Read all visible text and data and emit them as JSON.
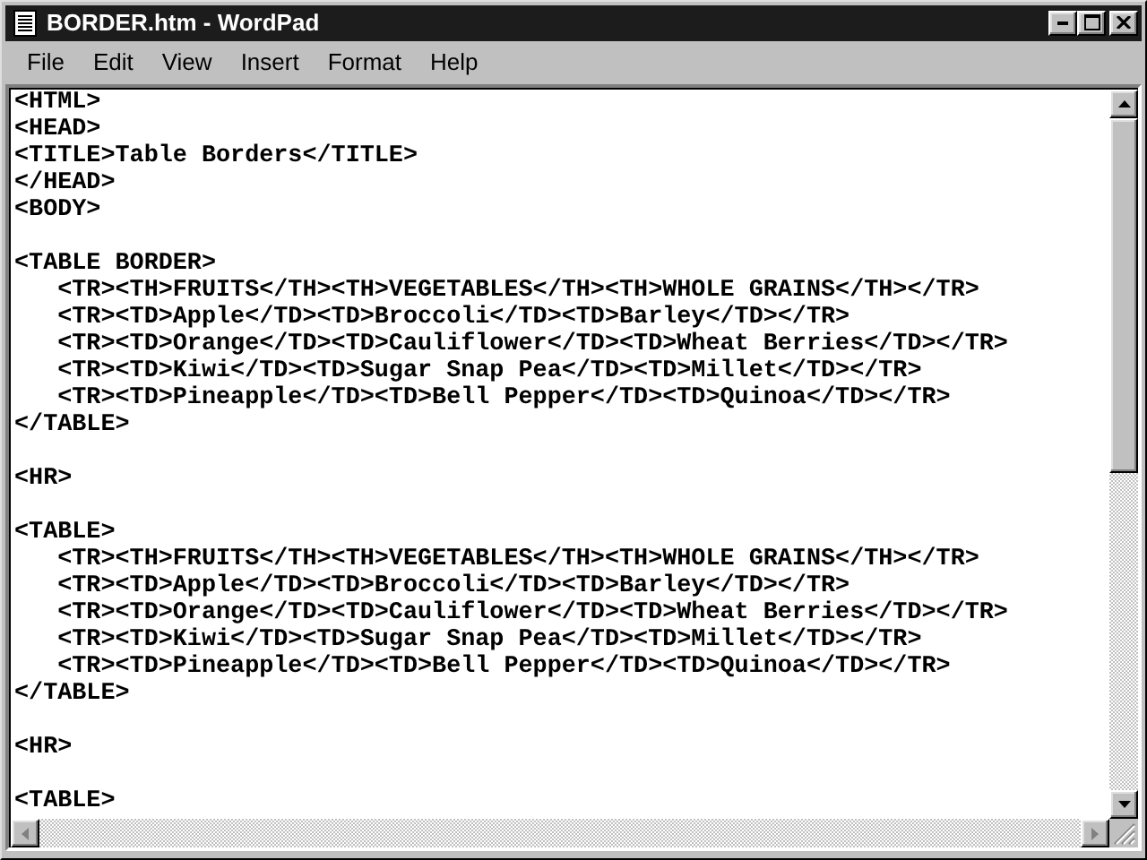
{
  "window": {
    "title": "BORDER.htm - WordPad"
  },
  "menu": [
    "File",
    "Edit",
    "View",
    "Insert",
    "Format",
    "Help"
  ],
  "document": {
    "lines": [
      {
        "kind": "text",
        "text": "<HTML>"
      },
      {
        "kind": "text",
        "text": "<HEAD>"
      },
      {
        "kind": "text",
        "text": "<TITLE>Table Borders</TITLE>"
      },
      {
        "kind": "text",
        "text": "</HEAD>"
      },
      {
        "kind": "text",
        "text": "<BODY>"
      },
      {
        "kind": "blank"
      },
      {
        "kind": "text",
        "text": "<TABLE BORDER>"
      },
      {
        "kind": "text",
        "text": "   <TR><TH>FRUITS</TH><TH>VEGETABLES</TH><TH>WHOLE GRAINS</TH></TR>"
      },
      {
        "kind": "text",
        "text": "   <TR><TD>Apple</TD><TD>Broccoli</TD><TD>Barley</TD></TR>"
      },
      {
        "kind": "text",
        "text": "   <TR><TD>Orange</TD><TD>Cauliflower</TD><TD>Wheat Berries</TD></TR>"
      },
      {
        "kind": "text",
        "text": "   <TR><TD>Kiwi</TD><TD>Sugar Snap Pea</TD><TD>Millet</TD></TR>"
      },
      {
        "kind": "text",
        "text": "   <TR><TD>Pineapple</TD><TD>Bell Pepper</TD><TD>Quinoa</TD></TR>"
      },
      {
        "kind": "text",
        "text": "</TABLE>"
      },
      {
        "kind": "blank"
      },
      {
        "kind": "text",
        "text": "<HR>"
      },
      {
        "kind": "blank"
      },
      {
        "kind": "text",
        "text": "<TABLE>"
      },
      {
        "kind": "text",
        "text": "   <TR><TH>FRUITS</TH><TH>VEGETABLES</TH><TH>WHOLE GRAINS</TH></TR>"
      },
      {
        "kind": "text",
        "text": "   <TR><TD>Apple</TD><TD>Broccoli</TD><TD>Barley</TD></TR>"
      },
      {
        "kind": "text",
        "text": "   <TR><TD>Orange</TD><TD>Cauliflower</TD><TD>Wheat Berries</TD></TR>"
      },
      {
        "kind": "text",
        "text": "   <TR><TD>Kiwi</TD><TD>Sugar Snap Pea</TD><TD>Millet</TD></TR>"
      },
      {
        "kind": "text",
        "text": "   <TR><TD>Pineapple</TD><TD>Bell Pepper</TD><TD>Quinoa</TD></TR>"
      },
      {
        "kind": "text",
        "text": "</TABLE>"
      },
      {
        "kind": "blank"
      },
      {
        "kind": "text",
        "text": "<HR>"
      },
      {
        "kind": "blank"
      },
      {
        "kind": "text",
        "text": "<TABLE>"
      }
    ]
  }
}
